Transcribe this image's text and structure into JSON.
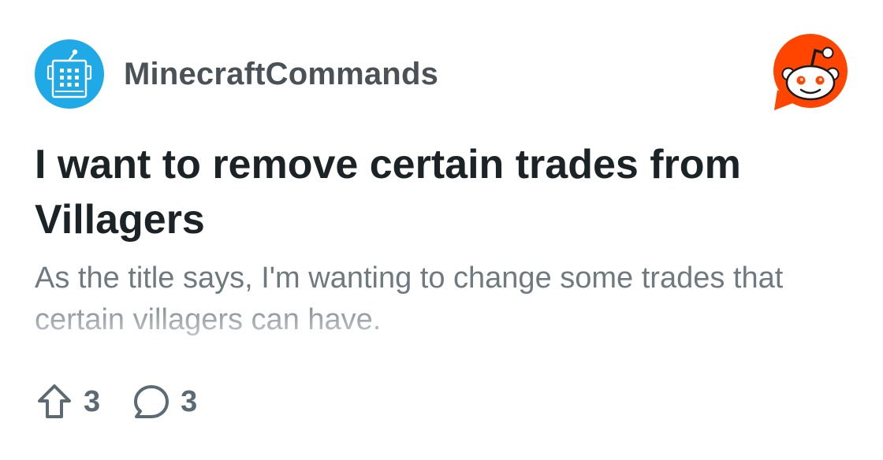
{
  "post": {
    "subreddit": "MinecraftCommands",
    "title": "I want to remove certain trades from Villagers",
    "body": "As the title says, I'm wanting to change some trades that certain villagers can have.",
    "upvotes": "3",
    "comments": "3"
  },
  "icons": {
    "subreddit_avatar": "command-block-icon",
    "brand_logo": "reddit-snoo-logo",
    "upvote": "upvote-arrow-icon",
    "comment": "comment-bubble-icon"
  },
  "colors": {
    "avatar_bg": "#1fa9e6",
    "reddit_orange": "#ff4500",
    "title": "#1c2326",
    "subreddit_name": "#4a5257",
    "body": "#6f7a80",
    "stats": "#5c6a73"
  }
}
